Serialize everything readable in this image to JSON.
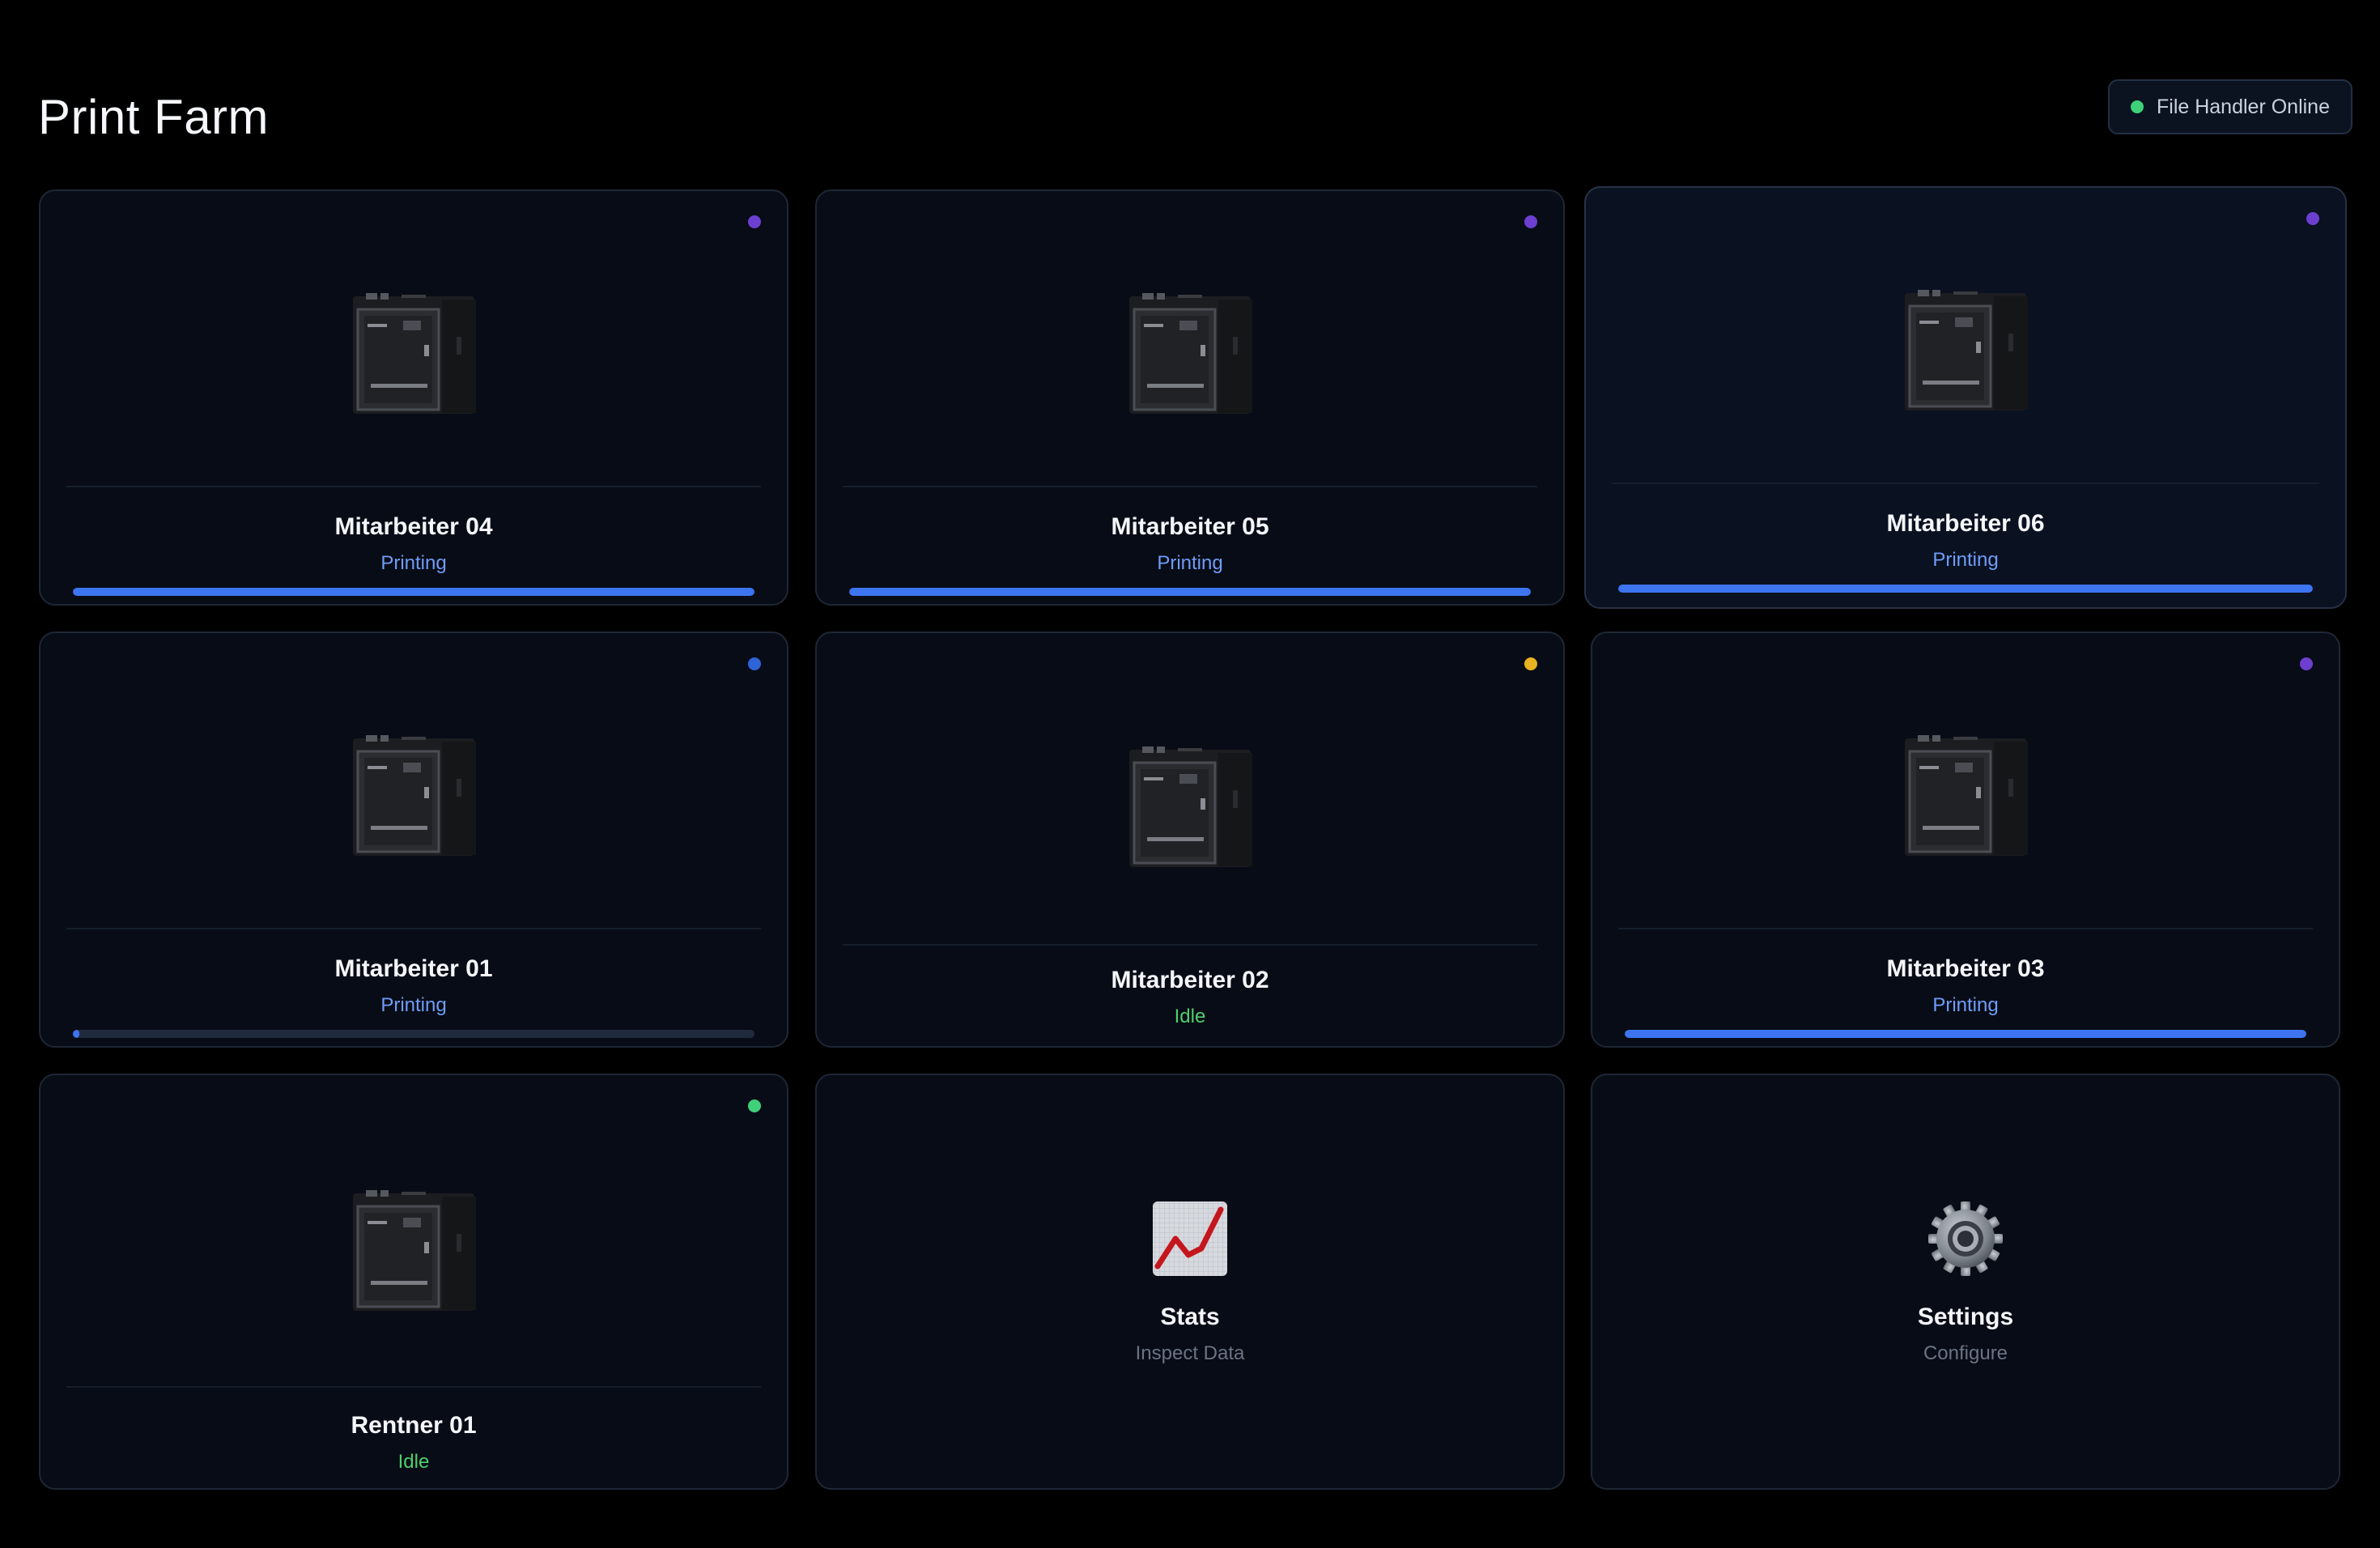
{
  "page": {
    "title": "Print Farm"
  },
  "status_pill": {
    "label": "File Handler Online",
    "dot_color": "#3fd07a"
  },
  "printers": [
    {
      "name": "Mitarbeiter 04",
      "status": "Printing",
      "led_color": "#6c3fd0",
      "progress": 1.0
    },
    {
      "name": "Mitarbeiter 05",
      "status": "Printing",
      "led_color": "#6c3fd0",
      "progress": 1.0
    },
    {
      "name": "Mitarbeiter 06",
      "status": "Printing",
      "led_color": "#6c3fd0",
      "progress": 1.0
    },
    {
      "name": "Mitarbeiter 01",
      "status": "Printing",
      "led_color": "#2f63d8",
      "progress": 0.01
    },
    {
      "name": "Mitarbeiter 02",
      "status": "Idle",
      "led_color": "#e8b320",
      "progress": null
    },
    {
      "name": "Mitarbeiter 03",
      "status": "Printing",
      "led_color": "#6c3fd0",
      "progress": 1.0
    },
    {
      "name": "Rentner 01",
      "status": "Idle",
      "led_color": "#3fd07a",
      "progress": null
    }
  ],
  "tiles": {
    "stats": {
      "title": "Stats",
      "subtitle": "Inspect Data",
      "icon": "chart-increasing-icon"
    },
    "settings": {
      "title": "Settings",
      "subtitle": "Configure",
      "icon": "gear-icon"
    }
  },
  "colors": {
    "background": "#000000",
    "card": "#080c16",
    "card_border": "#1e2735",
    "progress_fill": "#3d74f0",
    "printing_text": "#6f9df8",
    "idle_text": "#4fcf6b"
  }
}
